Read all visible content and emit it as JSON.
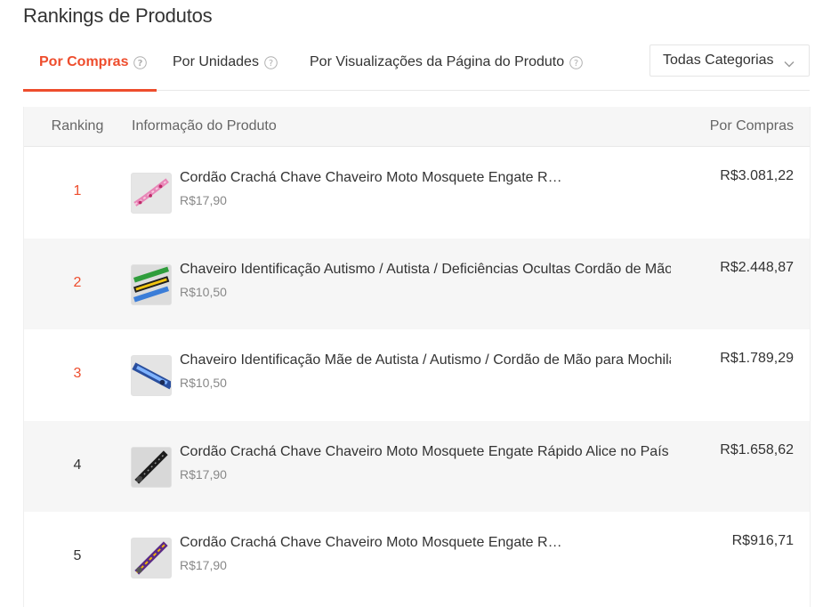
{
  "page": {
    "title": "Rankings de Produtos"
  },
  "tabs": [
    {
      "label": "Por Compras",
      "active": true
    },
    {
      "label": "Por Unidades",
      "active": false
    },
    {
      "label": "Por Visualizações da Página do Produto",
      "active": false
    }
  ],
  "category_filter": {
    "selected": "Todas Categorias"
  },
  "table": {
    "headers": {
      "rank": "Ranking",
      "info": "Informação do Produto",
      "purchases": "Por Compras"
    },
    "rows": [
      {
        "rank": "1",
        "name": "Cordão Crachá Chave Chaveiro Moto Mosquete Engate Rápido Moranguinho",
        "price": "R$17,90",
        "purchases": "R$3.081,22"
      },
      {
        "rank": "2",
        "name": "Chaveiro Identificação Autismo / Autista / Deficiências Ocultas Cordão de Mão",
        "price": "R$10,50",
        "purchases": "R$2.448,87"
      },
      {
        "rank": "3",
        "name": "Chaveiro Identificação Mãe de Autista / Autismo / Cordão de Mão para Mochila",
        "price": "R$10,50",
        "purchases": "R$1.789,29"
      },
      {
        "rank": "4",
        "name": "Cordão Crachá Chave Chaveiro Moto Mosquete Engate Rápido Alice no País das",
        "price": "R$17,90",
        "purchases": "R$1.658,62"
      },
      {
        "rank": "5",
        "name": "Cordão Crachá Chave Chaveiro Moto Mosquete Engate Rápido Lakers NBA",
        "price": "R$17,90",
        "purchases": "R$916,71"
      }
    ]
  },
  "colors": {
    "accent": "#ee4d2d",
    "header_bg": "#f6f6f6",
    "muted_text": "#888888"
  },
  "icons": {
    "help": "question-circle-icon",
    "dropdown": "chevron-down-icon"
  }
}
